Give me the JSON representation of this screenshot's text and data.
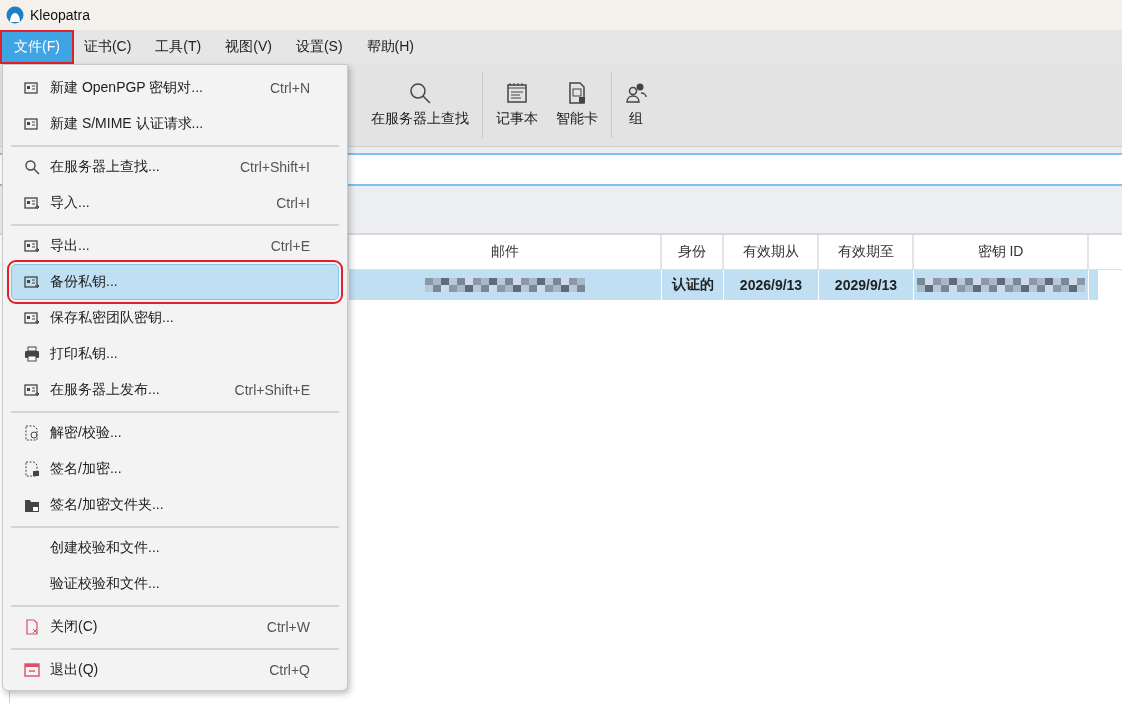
{
  "window": {
    "title": "Kleopatra"
  },
  "menubar": [
    {
      "label": "文件(F)",
      "selected": true,
      "highlighted": true
    },
    {
      "label": "证书(C)",
      "selected": false,
      "highlighted": false
    },
    {
      "label": "工具(T)",
      "selected": false,
      "highlighted": false
    },
    {
      "label": "视图(V)",
      "selected": false,
      "highlighted": false
    },
    {
      "label": "设置(S)",
      "selected": false,
      "highlighted": false
    },
    {
      "label": "帮助(H)",
      "selected": false,
      "highlighted": false
    }
  ],
  "toolbar": [
    {
      "kind": "button",
      "label": "在服务器上查找"
    },
    {
      "kind": "separator"
    },
    {
      "kind": "button",
      "label": "记事本"
    },
    {
      "kind": "button",
      "label": "智能卡"
    },
    {
      "kind": "separator"
    },
    {
      "kind": "button",
      "label": "组"
    }
  ],
  "table": {
    "columns": [
      "邮件",
      "身份",
      "有效期从",
      "有效期至",
      "密钥 ID"
    ],
    "rows": [
      {
        "selected": true,
        "cells": [
          {
            "kind": "redacted"
          },
          {
            "kind": "text",
            "text": "认证的"
          },
          {
            "kind": "text",
            "text": "2026/9/13"
          },
          {
            "kind": "text",
            "text": "2029/9/13"
          },
          {
            "kind": "redacted"
          }
        ]
      }
    ]
  },
  "file_menu": [
    {
      "kind": "item",
      "label": "新建 OpenPGP 密钥对...",
      "shortcut": "Ctrl+N",
      "selected": false,
      "highlighted": false
    },
    {
      "kind": "item",
      "label": "新建 S/MIME 认证请求...",
      "selected": false,
      "highlighted": false
    },
    {
      "kind": "separator"
    },
    {
      "kind": "item",
      "label": "在服务器上查找...",
      "shortcut": "Ctrl+Shift+I",
      "selected": false,
      "highlighted": false
    },
    {
      "kind": "item",
      "label": "导入...",
      "shortcut": "Ctrl+I",
      "selected": false,
      "highlighted": false
    },
    {
      "kind": "separator"
    },
    {
      "kind": "item",
      "label": "导出...",
      "shortcut": "Ctrl+E",
      "selected": false,
      "highlighted": false
    },
    {
      "kind": "item",
      "label": "备份私钥...",
      "selected": true,
      "highlighted": true
    },
    {
      "kind": "item",
      "label": "保存私密团队密钥...",
      "selected": false,
      "highlighted": false
    },
    {
      "kind": "item",
      "label": "打印私钥...",
      "selected": false,
      "highlighted": false
    },
    {
      "kind": "item",
      "label": "在服务器上发布...",
      "shortcut": "Ctrl+Shift+E",
      "selected": false,
      "highlighted": false
    },
    {
      "kind": "separator"
    },
    {
      "kind": "item",
      "label": "解密/校验...",
      "selected": false,
      "highlighted": false
    },
    {
      "kind": "item",
      "label": "签名/加密...",
      "selected": false,
      "highlighted": false
    },
    {
      "kind": "item",
      "label": "签名/加密文件夹...",
      "selected": false,
      "highlighted": false
    },
    {
      "kind": "separator"
    },
    {
      "kind": "item",
      "label": "创建校验和文件...",
      "selected": false,
      "highlighted": false
    },
    {
      "kind": "item",
      "label": "验证校验和文件...",
      "selected": false,
      "highlighted": false
    },
    {
      "kind": "separator"
    },
    {
      "kind": "item",
      "label": "关闭(C)",
      "shortcut": "Ctrl+W",
      "selected": false,
      "highlighted": false
    },
    {
      "kind": "separator"
    },
    {
      "kind": "item",
      "label": "退出(Q)",
      "shortcut": "Ctrl+Q",
      "selected": false,
      "highlighted": false
    }
  ]
}
